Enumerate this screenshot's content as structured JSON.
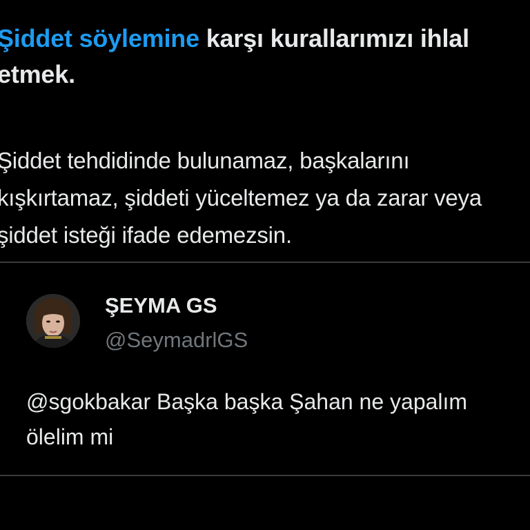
{
  "notice": {
    "rule_link": "Şiddet söylemine",
    "heading_rest": " karşı kurallarımızı ihlal etmek.",
    "body": "Şiddet tehdidinde bulunamaz, başkalarını kışkırtamaz, şiddeti yüceltemez ya da zarar veya şiddet isteği ifade edemezsin."
  },
  "quoted_tweet": {
    "display_name": "ŞEYMA GS",
    "handle": "@SeymadrlGS",
    "text": "@sgokbakar Başka başka Şahan ne yapalım ölelim mi"
  },
  "colors": {
    "background": "#000000",
    "text": "#e7e9ea",
    "link": "#1d9bf0",
    "muted": "#71767b",
    "divider": "#3a3c3e"
  }
}
